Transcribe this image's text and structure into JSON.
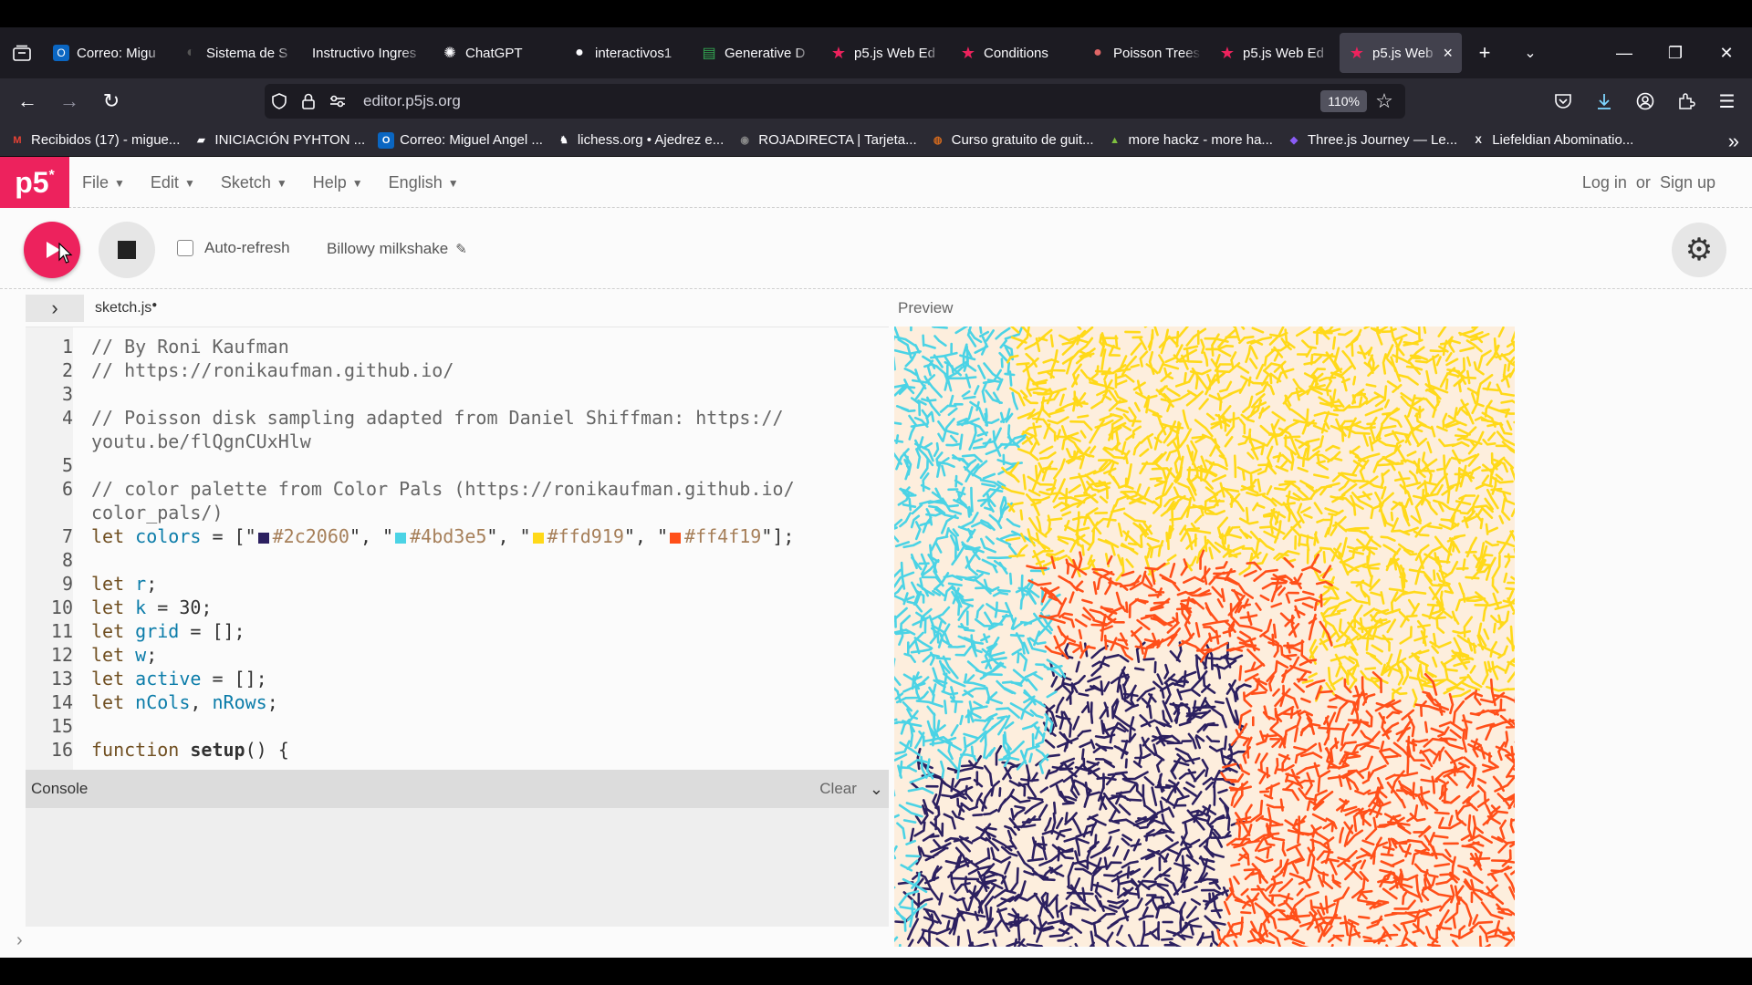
{
  "browser": {
    "tabs": [
      {
        "label": "Correo: Migu",
        "icon": "outlook-icon",
        "color": "#0a66c2"
      },
      {
        "label": "Sistema de S",
        "icon": "globe-icon",
        "color": "#3a3a3a"
      },
      {
        "label": "Instructivo Ingres",
        "icon": "",
        "color": ""
      },
      {
        "label": "ChatGPT",
        "icon": "chatgpt-icon",
        "color": "#fbfbfe"
      },
      {
        "label": "interactivos1",
        "icon": "github-icon",
        "color": "#fbfbfe"
      },
      {
        "label": "Generative D",
        "icon": "sheet-icon",
        "color": "#34a853"
      },
      {
        "label": "p5.js Web Ed",
        "icon": "p5-star-icon",
        "color": "#ed225d"
      },
      {
        "label": "Conditions",
        "icon": "p5-star-icon",
        "color": "#ed225d"
      },
      {
        "label": "Poisson Trees",
        "icon": "processing-icon",
        "color": "#e06666"
      },
      {
        "label": "p5.js Web Ed",
        "icon": "p5-star-icon",
        "color": "#ed225d"
      },
      {
        "label": "p5.js Web",
        "icon": "p5-star-icon",
        "color": "#ed225d",
        "active": true
      }
    ],
    "url": "editor.p5js.org",
    "zoom": "110%",
    "bookmarks": [
      {
        "label": "Recibidos (17) - migue...",
        "icon": "gmail-icon",
        "color": "#ea4335"
      },
      {
        "label": "INICIACIÓN PYHTON ...",
        "icon": "folder-icon",
        "color": "#fbfbfe"
      },
      {
        "label": "Correo: Miguel Angel ...",
        "icon": "outlook-icon",
        "color": "#0a66c2"
      },
      {
        "label": "lichess.org • Ajedrez e...",
        "icon": "lichess-icon",
        "color": "#fbfbfe"
      },
      {
        "label": "ROJADIRECTA | Tarjeta...",
        "icon": "camera-icon",
        "color": "#888888"
      },
      {
        "label": "Curso gratuito de guit...",
        "icon": "guitar-icon",
        "color": "#d2691e"
      },
      {
        "label": "more hackz - more ha...",
        "icon": "hackz-icon",
        "color": "#7fbf3f"
      },
      {
        "label": "Three.js Journey — Le...",
        "icon": "threejs-icon",
        "color": "#8a5cf6"
      },
      {
        "label": "Liefeldian Abominatio...",
        "icon": "x-icon",
        "color": "#fbfbfe"
      }
    ]
  },
  "p5": {
    "logo": "p5",
    "menu": [
      "File",
      "Edit",
      "Sketch",
      "Help",
      "English"
    ],
    "auth": {
      "login": "Log in",
      "or": "or",
      "signup": "Sign up"
    },
    "auto_refresh": "Auto-refresh",
    "sketch_name": "Billowy milkshake",
    "file_name": "sketch.js",
    "preview_label": "Preview",
    "console": {
      "title": "Console",
      "clear": "Clear"
    }
  },
  "code": [
    {
      "n": "1",
      "text": "// By Roni Kaufman"
    },
    {
      "n": "2",
      "text": "// https://ronikaufman.github.io/"
    },
    {
      "n": "3",
      "text": ""
    },
    {
      "n": "4",
      "text": "// Poisson disk sampling adapted from Daniel Shiffman: https://"
    },
    {
      "n": "",
      "text": "youtu.be/flQgnCUxHlw"
    },
    {
      "n": "5",
      "text": ""
    },
    {
      "n": "6",
      "text": "// color palette from Color Pals (https://ronikaufman.github.io/"
    },
    {
      "n": "",
      "text": "color_pals/)"
    },
    {
      "n": "7",
      "text": "let colors = [\"#2c2060\", \"#4bd3e5\", \"#ffd919\", \"#ff4f19\"];"
    },
    {
      "n": "8",
      "text": ""
    },
    {
      "n": "9",
      "text": "let r;"
    },
    {
      "n": "10",
      "text": "let k = 30;"
    },
    {
      "n": "11",
      "text": "let grid = [];"
    },
    {
      "n": "12",
      "text": "let w;"
    },
    {
      "n": "13",
      "text": "let active = [];"
    },
    {
      "n": "14",
      "text": "let nCols, nRows;"
    },
    {
      "n": "15",
      "text": ""
    },
    {
      "n": "16",
      "text": "function setup() {"
    }
  ],
  "palette": [
    "#2c2060",
    "#4bd3e5",
    "#ffd919",
    "#ff4f19"
  ],
  "preview_bg": "#fdeedd"
}
